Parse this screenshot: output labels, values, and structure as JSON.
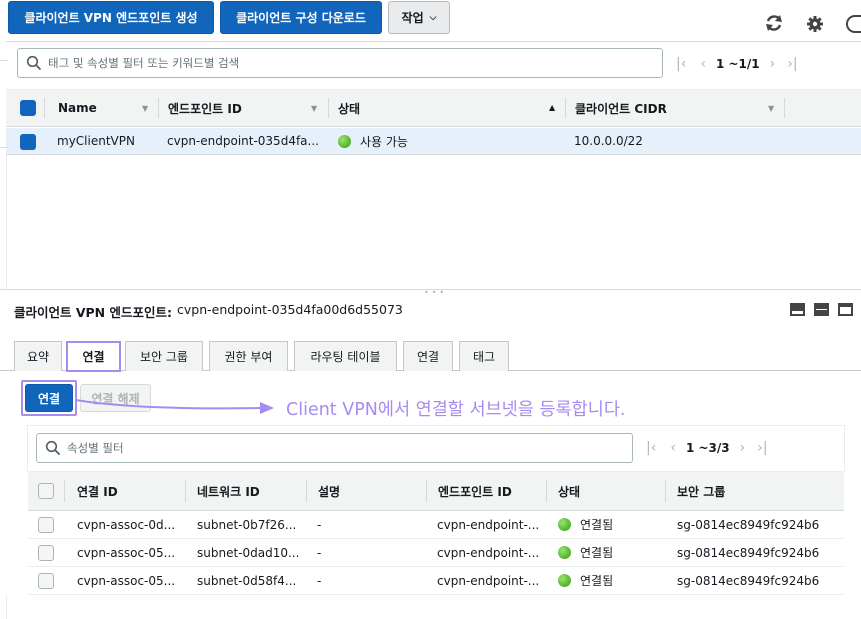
{
  "toolbar": {
    "create_button": "클라이언트 VPN 엔드포인트 생성",
    "download_button": "클라이언트 구성 다운로드",
    "actions_button": "작업"
  },
  "top_search": {
    "placeholder": "태그 및 속성별 필터 또는 키워드별 검색"
  },
  "top_pager": {
    "text": "1 ~1/1"
  },
  "top_table": {
    "columns": [
      "Name",
      "엔드포인트 ID",
      "상태",
      "클라이언트 CIDR"
    ],
    "row": {
      "name": "myClientVPN",
      "endpoint_id": "cvpn-endpoint-035d4fa...",
      "status": "사용 가능",
      "cidr": "10.0.0.0/22"
    }
  },
  "detail": {
    "label": "클라이언트 VPN 엔드포인트:",
    "value": "cvpn-endpoint-035d4fa00d6d55073"
  },
  "tabs": [
    "요약",
    "연결",
    "보안 그룹",
    "권한 부여",
    "라우팅 테이블",
    "연결",
    "태그"
  ],
  "assoc": {
    "associate_button": "연결",
    "disassociate_button": "연결 해제",
    "annotation": "Client VPN에서 연결할 서브넷을 등록합니다.",
    "annotation_color": "#a58cf0",
    "search_placeholder": "속성별 필터",
    "pager": "1 ~3/3",
    "columns": [
      "연결 ID",
      "네트워크 ID",
      "설명",
      "엔드포인트 ID",
      "상태",
      "보안 그룹"
    ],
    "rows": [
      {
        "id": "cvpn-assoc-0d...",
        "network": "subnet-0b7f26...",
        "desc": "-",
        "endpoint": "cvpn-endpoint-...",
        "status": "연결됨",
        "sg": "sg-0814ec8949fc924b6"
      },
      {
        "id": "cvpn-assoc-05...",
        "network": "subnet-0dad10...",
        "desc": "-",
        "endpoint": "cvpn-endpoint-...",
        "status": "연결됨",
        "sg": "sg-0814ec8949fc924b6"
      },
      {
        "id": "cvpn-assoc-05...",
        "network": "subnet-0d58f4...",
        "desc": "-",
        "endpoint": "cvpn-endpoint-...",
        "status": "연결됨",
        "sg": "sg-0814ec8949fc924b6"
      }
    ]
  },
  "colors": {
    "primary": "#1166bb",
    "highlight": "#a58cf0",
    "selected_row": "#e6f0fa"
  }
}
